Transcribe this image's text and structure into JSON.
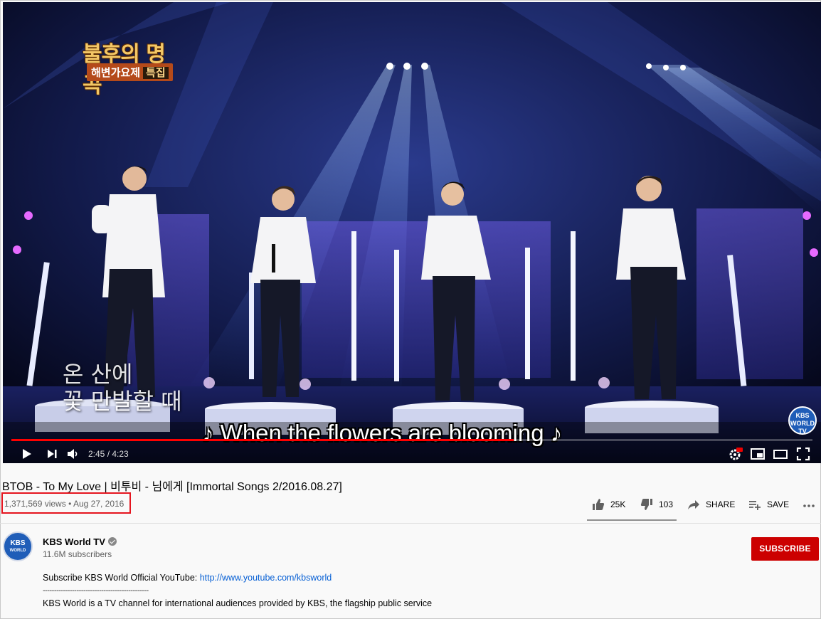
{
  "video": {
    "program_logo": "불후의 명곡",
    "program_subtitle": "해변가요제",
    "program_tag": "특집",
    "lyric_korean_line1": "온 산에",
    "lyric_korean_line2": "꽃 만발할 때",
    "caption": "♪ When the flowers are blooming ♪",
    "watermark": "KBS WORLD TV",
    "time_display": "2:45 / 4:23",
    "progress": 0.627
  },
  "info": {
    "title": "BTOB - To My Love | 비투비 - 님에게 [Immortal Songs 2/2016.08.27]",
    "views": "1,371,569 views",
    "date": "Aug 27, 2016",
    "likes": "25K",
    "dislikes": "103",
    "share_label": "SHARE",
    "save_label": "SAVE"
  },
  "channel": {
    "name": "KBS World TV",
    "subscribers": "11.6M subscribers",
    "avatar_text": "KBS WORLD TV",
    "subscribe_label": "SUBSCRIBE"
  },
  "description": {
    "line1_prefix": "Subscribe KBS World Official YouTube: ",
    "line1_link": "http://www.youtube.com/kbsworld",
    "separator": "-----------------------------------------------",
    "line2": "KBS World is a TV channel for international audiences provided by KBS, the flagship public service"
  },
  "colors": {
    "progress_red": "#ff0000",
    "subscribe_red": "#cc0000",
    "link_blue": "#065fd4",
    "highlight_box": "#e5151f"
  }
}
